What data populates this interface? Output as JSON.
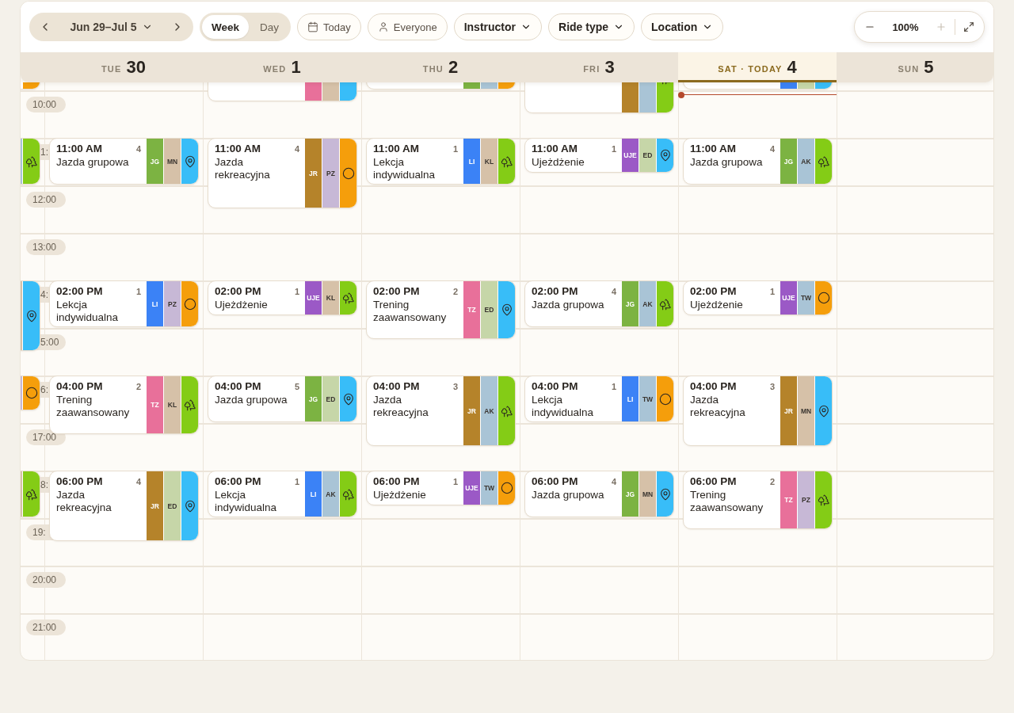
{
  "toolbar": {
    "range": "Jun 29–Jul 5",
    "views": [
      {
        "label": "Week",
        "selected": true
      },
      {
        "label": "Day",
        "selected": false
      }
    ],
    "buttons": [
      "Today",
      "Everyone"
    ],
    "filters": [
      "Instructor",
      "Ride type",
      "Location"
    ],
    "zoom": {
      "value": "100%",
      "zoom_in_disabled": true
    }
  },
  "days": [
    {
      "weekday": "TUE",
      "date": "30",
      "today": false
    },
    {
      "weekday": "WED",
      "date": "1",
      "today": false
    },
    {
      "weekday": "THU",
      "date": "2",
      "today": false
    },
    {
      "weekday": "FRI",
      "date": "3",
      "today": false
    },
    {
      "weekday": "SAT · TODAY",
      "date": "4",
      "today": true
    },
    {
      "weekday": "SUN",
      "date": "5",
      "today": false
    }
  ],
  "rows": [
    {
      "cells": [
        {
          "kind": "hour",
          "location": {
            "color": "#f59e0b"
          }
        },
        {
          "kind": "free"
        },
        {
          "kind": "long",
          "badges": [
            {
              "kind": "type",
              "color": "#e8709a"
            },
            {
              "kind": "instructor",
              "color": "#d6c1a8"
            }
          ],
          "location": {
            "color": "#38bdf8"
          }
        },
        {
          "kind": "hour",
          "badges": [
            {
              "kind": "type",
              "color": "#7cb342"
            },
            {
              "kind": "instructor",
              "color": "#a9c4d6"
            }
          ],
          "location": {
            "color": "#f59e0b"
          }
        },
        {
          "kind": "longer",
          "badges": [
            {
              "kind": "type",
              "color": "#b5832a"
            },
            {
              "kind": "instructor",
              "color": "#a9c4d6"
            }
          ],
          "location": {
            "kind": "trees"
          }
        },
        {
          "kind": "hour",
          "badges": [
            {
              "kind": "type",
              "color": "#3b82f6"
            },
            {
              "kind": "instructor",
              "color": "#c6d6a8"
            }
          ],
          "location": {
            "color": "#38bdf8"
          }
        },
        {
          "kind": "free"
        }
      ]
    },
    {
      "label": {
        "text": "10:00",
        "kind": "full"
      },
      "cells": [
        {
          "kind": "free"
        },
        {
          "kind": "free"
        },
        {
          "kind": "free"
        },
        {
          "kind": "free"
        },
        {
          "kind": "free"
        },
        {
          "kind": "now"
        },
        {
          "kind": "free"
        }
      ]
    },
    {
      "label": {
        "text": "1:",
        "kind": "clipped"
      },
      "cells": [
        {
          "kind": "hour",
          "badges": [
            {
              "kind": "instructor",
              "color": "#a9c4d6"
            }
          ],
          "location": {
            "kind": "trees"
          }
        },
        {
          "kind": "hour",
          "time": "11:00 AM",
          "count": "4",
          "title": "Jazda grupowa",
          "badges": [
            {
              "kind": "type",
              "text": "JG",
              "color": "#7cb342"
            },
            {
              "kind": "instructor",
              "text": "MN",
              "color": "#d6c1a8"
            }
          ],
          "location": {
            "kind": "pin"
          }
        },
        {
          "kind": "longer",
          "time": "11:00 AM",
          "count": "4",
          "title": "Jazda rekreacyjna",
          "badges": [
            {
              "kind": "type",
              "text": "JR",
              "color": "#b5832a"
            },
            {
              "kind": "instructor",
              "text": "PZ",
              "color": "#c7b8d6"
            }
          ],
          "location": {
            "kind": "circle"
          }
        },
        {
          "kind": "hour",
          "time": "11:00 AM",
          "count": "1",
          "title": "Lekcja indywidualna",
          "badges": [
            {
              "kind": "type",
              "text": "LI",
              "color": "#3b82f6"
            },
            {
              "kind": "instructor",
              "text": "KL",
              "color": "#d6c1a8"
            }
          ],
          "location": {
            "kind": "trees"
          }
        },
        {
          "kind": "short",
          "time": "11:00 AM",
          "count": "1",
          "title": "Ujeżdżenie",
          "badges": [
            {
              "kind": "type",
              "text": "UJE",
              "color": "#9b59c6"
            },
            {
              "kind": "instructor",
              "text": "ED",
              "color": "#c6d6a8"
            }
          ],
          "location": {
            "kind": "pin"
          }
        },
        {
          "kind": "hour",
          "time": "11:00 AM",
          "count": "4",
          "title": "Jazda grupowa",
          "badges": [
            {
              "kind": "type",
              "text": "JG",
              "color": "#7cb342"
            },
            {
              "kind": "instructor",
              "text": "AK",
              "color": "#a9c4d6"
            }
          ],
          "location": {
            "kind": "trees"
          }
        },
        {
          "kind": "free"
        }
      ]
    },
    {
      "label": {
        "text": "12:00",
        "kind": "full"
      },
      "cells": [
        {
          "kind": "free"
        },
        {
          "kind": "free"
        },
        {
          "kind": "free"
        },
        {
          "kind": "free"
        },
        {
          "kind": "free"
        },
        {
          "kind": "free"
        },
        {
          "kind": "free"
        }
      ]
    },
    {
      "label": {
        "text": "13:00",
        "kind": "full"
      },
      "cells": [
        {
          "kind": "free"
        },
        {
          "kind": "free"
        },
        {
          "kind": "free"
        },
        {
          "kind": "free"
        },
        {
          "kind": "free"
        },
        {
          "kind": "free"
        },
        {
          "kind": "free"
        }
      ]
    },
    {
      "label": {
        "text": "4:",
        "kind": "clipped"
      },
      "cells": [
        {
          "kind": "longer",
          "badges": [
            {
              "kind": "instructor",
              "color": "#d6c1a8"
            }
          ],
          "location": {
            "kind": "pin"
          }
        },
        {
          "kind": "hour",
          "time": "02:00 PM",
          "count": "1",
          "title": "Lekcja indywidualna",
          "badges": [
            {
              "kind": "type",
              "text": "LI",
              "color": "#3b82f6"
            },
            {
              "kind": "instructor",
              "text": "PZ",
              "color": "#c7b8d6"
            }
          ],
          "location": {
            "kind": "circle"
          }
        },
        {
          "kind": "short",
          "time": "02:00 PM",
          "count": "1",
          "title": "Ujeżdżenie",
          "badges": [
            {
              "kind": "type",
              "text": "UJE",
              "color": "#9b59c6"
            },
            {
              "kind": "instructor",
              "text": "KL",
              "color": "#d6c1a8"
            }
          ],
          "location": {
            "kind": "trees"
          }
        },
        {
          "kind": "long",
          "time": "02:00 PM",
          "count": "2",
          "title": "Trening zaawansowany",
          "badges": [
            {
              "kind": "type",
              "text": "TZ",
              "color": "#e8709a"
            },
            {
              "kind": "instructor",
              "text": "ED",
              "color": "#c6d6a8"
            }
          ],
          "location": {
            "kind": "pin"
          }
        },
        {
          "kind": "hour",
          "time": "02:00 PM",
          "count": "4",
          "title": "Jazda grupowa",
          "badges": [
            {
              "kind": "type",
              "text": "JG",
              "color": "#7cb342"
            },
            {
              "kind": "instructor",
              "text": "AK",
              "color": "#a9c4d6"
            }
          ],
          "location": {
            "kind": "trees"
          }
        },
        {
          "kind": "short",
          "time": "02:00 PM",
          "count": "1",
          "title": "Ujeżdżenie",
          "badges": [
            {
              "kind": "type",
              "text": "UJE",
              "color": "#9b59c6"
            },
            {
              "kind": "instructor",
              "text": "TW",
              "color": "#a9c4d6"
            }
          ],
          "location": {
            "kind": "circle"
          }
        },
        {
          "kind": "free"
        }
      ]
    },
    {
      "label": {
        "text": "5:00",
        "kind": "clipped"
      },
      "cells": [
        {
          "kind": "free"
        },
        {
          "kind": "free"
        },
        {
          "kind": "free"
        },
        {
          "kind": "free"
        },
        {
          "kind": "free"
        },
        {
          "kind": "free"
        },
        {
          "kind": "free"
        }
      ]
    },
    {
      "label": {
        "text": "6:",
        "kind": "clipped"
      },
      "cells": [
        {
          "kind": "short",
          "badges": [
            {
              "kind": "instructor",
              "color": "#c7b8d6"
            }
          ],
          "location": {
            "kind": "circle"
          }
        },
        {
          "kind": "long",
          "time": "04:00 PM",
          "count": "2",
          "title": "Trening zaawansowany",
          "badges": [
            {
              "kind": "type",
              "text": "TZ",
              "color": "#e8709a"
            },
            {
              "kind": "instructor",
              "text": "KL",
              "color": "#d6c1a8"
            }
          ],
          "location": {
            "kind": "trees"
          }
        },
        {
          "kind": "hour",
          "time": "04:00 PM",
          "count": "5",
          "title": "Jazda grupowa",
          "badges": [
            {
              "kind": "type",
              "text": "JG",
              "color": "#7cb342"
            },
            {
              "kind": "instructor",
              "text": "ED",
              "color": "#c6d6a8"
            }
          ],
          "location": {
            "kind": "pin"
          }
        },
        {
          "kind": "longer",
          "time": "04:00 PM",
          "count": "3",
          "title": "Jazda rekreacyjna",
          "badges": [
            {
              "kind": "type",
              "text": "JR",
              "color": "#b5832a"
            },
            {
              "kind": "instructor",
              "text": "AK",
              "color": "#a9c4d6"
            }
          ],
          "location": {
            "kind": "trees"
          }
        },
        {
          "kind": "hour",
          "time": "04:00 PM",
          "count": "1",
          "title": "Lekcja indywidualna",
          "badges": [
            {
              "kind": "type",
              "text": "LI",
              "color": "#3b82f6"
            },
            {
              "kind": "instructor",
              "text": "TW",
              "color": "#a9c4d6"
            }
          ],
          "location": {
            "kind": "circle"
          }
        },
        {
          "kind": "longer",
          "time": "04:00 PM",
          "count": "3",
          "title": "Jazda rekreacyjna",
          "badges": [
            {
              "kind": "type",
              "text": "JR",
              "color": "#b5832a"
            },
            {
              "kind": "instructor",
              "text": "MN",
              "color": "#d6c1a8"
            }
          ],
          "location": {
            "kind": "pin"
          }
        },
        {
          "kind": "free"
        }
      ]
    },
    {
      "label": {
        "text": "17:00",
        "kind": "full"
      },
      "cells": [
        {
          "kind": "free"
        },
        {
          "kind": "free"
        },
        {
          "kind": "free"
        },
        {
          "kind": "free"
        },
        {
          "kind": "free"
        },
        {
          "kind": "free"
        },
        {
          "kind": "free"
        }
      ]
    },
    {
      "label": {
        "text": "8:",
        "kind": "clipped"
      },
      "cells": [
        {
          "kind": "hour",
          "badges": [
            {
              "kind": "instructor",
              "color": "#d6c1a8"
            }
          ],
          "location": {
            "kind": "trees"
          }
        },
        {
          "kind": "longer",
          "time": "06:00 PM",
          "count": "4",
          "title": "Jazda rekreacyjna",
          "badges": [
            {
              "kind": "type",
              "text": "JR",
              "color": "#b5832a"
            },
            {
              "kind": "instructor",
              "text": "ED",
              "color": "#c6d6a8"
            }
          ],
          "location": {
            "kind": "pin"
          }
        },
        {
          "kind": "hour",
          "time": "06:00 PM",
          "count": "1",
          "title": "Lekcja indywidualna",
          "badges": [
            {
              "kind": "type",
              "text": "LI",
              "color": "#3b82f6"
            },
            {
              "kind": "instructor",
              "text": "AK",
              "color": "#a9c4d6"
            }
          ],
          "location": {
            "kind": "trees"
          }
        },
        {
          "kind": "short",
          "time": "06:00 PM",
          "count": "1",
          "title": "Ujeżdżenie",
          "badges": [
            {
              "kind": "type",
              "text": "UJE",
              "color": "#9b59c6"
            },
            {
              "kind": "instructor",
              "text": "TW",
              "color": "#a9c4d6"
            }
          ],
          "location": {
            "kind": "circle"
          }
        },
        {
          "kind": "hour",
          "time": "06:00 PM",
          "count": "4",
          "title": "Jazda grupowa",
          "badges": [
            {
              "kind": "type",
              "text": "JG",
              "color": "#7cb342"
            },
            {
              "kind": "instructor",
              "text": "MN",
              "color": "#d6c1a8"
            }
          ],
          "location": {
            "kind": "pin"
          }
        },
        {
          "kind": "long",
          "time": "06:00 PM",
          "count": "2",
          "title": "Trening zaawansowany",
          "badges": [
            {
              "kind": "type",
              "text": "TZ",
              "color": "#e8709a"
            },
            {
              "kind": "instructor",
              "text": "PZ",
              "color": "#c7b8d6"
            }
          ],
          "location": {
            "kind": "trees"
          }
        },
        {
          "kind": "free"
        }
      ]
    },
    {
      "label": {
        "text": "19:",
        "kind": "full"
      },
      "cells": [
        {
          "kind": "free"
        },
        {
          "kind": "free"
        },
        {
          "kind": "free"
        },
        {
          "kind": "free"
        },
        {
          "kind": "free"
        },
        {
          "kind": "free"
        },
        {
          "kind": "free"
        }
      ]
    },
    {
      "label": {
        "text": "20:00",
        "kind": "full"
      },
      "cells": [
        {
          "kind": "free"
        },
        {
          "kind": "free"
        },
        {
          "kind": "free"
        },
        {
          "kind": "free"
        },
        {
          "kind": "free"
        },
        {
          "kind": "free"
        },
        {
          "kind": "free"
        }
      ]
    },
    {
      "label": {
        "text": "21:00",
        "kind": "full"
      },
      "cells": [
        {
          "kind": "free"
        },
        {
          "kind": "free"
        },
        {
          "kind": "free"
        },
        {
          "kind": "free"
        },
        {
          "kind": "free"
        },
        {
          "kind": "free"
        },
        {
          "kind": "free"
        }
      ]
    }
  ]
}
